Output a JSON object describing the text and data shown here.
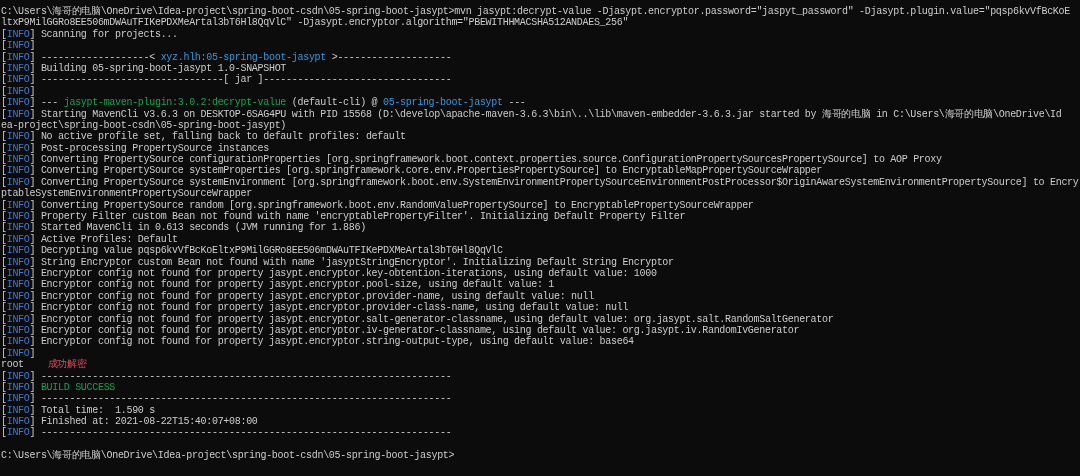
{
  "terminal": {
    "lines": [
      {
        "segments": [
          {
            "kind": "text",
            "text": "C:\\Users\\海哥的电脑\\OneDrive\\Idea-project\\spring-boot-csdn\\05-spring-boot-jasypt>mvn jasypt:decrypt-value -Djasypt.encryptor.password=\"jaspyt_password\" -Djasypt.plugin.value=\"pqsp6kvVfBcKoE"
          }
        ]
      },
      {
        "segments": [
          {
            "kind": "text",
            "text": "ltxP9MilGGRo8EE506mDWAuTFIKePDXMeArtal3bT6Hl8QqVlC\" -Djasypt.encryptor.algorithm=\"PBEWITHHMACSHA512ANDAES_256\""
          }
        ]
      },
      {
        "segments": [
          {
            "kind": "bracket",
            "text": "["
          },
          {
            "kind": "level",
            "text": "INFO"
          },
          {
            "kind": "bracket",
            "text": "]"
          },
          {
            "kind": "text",
            "text": "Scanning for projects..."
          }
        ]
      },
      {
        "segments": [
          {
            "kind": "bracket",
            "text": "["
          },
          {
            "kind": "level",
            "text": "INFO"
          },
          {
            "kind": "bracket",
            "text": "]"
          }
        ]
      },
      {
        "segments": [
          {
            "kind": "bracket",
            "text": "["
          },
          {
            "kind": "level",
            "text": "INFO"
          },
          {
            "kind": "bracket",
            "text": "]"
          },
          {
            "kind": "text",
            "text": "-------------------<"
          },
          {
            "kind": "artifact",
            "text": "xyz.hlh:05-spring-boot-jasypt"
          },
          {
            "kind": "text",
            "text": ">--------------------"
          }
        ]
      },
      {
        "segments": [
          {
            "kind": "bracket",
            "text": "["
          },
          {
            "kind": "level",
            "text": "INFO"
          },
          {
            "kind": "bracket",
            "text": "]"
          },
          {
            "kind": "text",
            "text": "Building 05-spring-boot-jasypt 1.0-SNAPSHOT"
          }
        ]
      },
      {
        "segments": [
          {
            "kind": "bracket",
            "text": "["
          },
          {
            "kind": "level",
            "text": "INFO"
          },
          {
            "kind": "bracket",
            "text": "]"
          },
          {
            "kind": "text",
            "text": "--------------------------------[ jar ]---------------------------------"
          }
        ]
      },
      {
        "segments": [
          {
            "kind": "bracket",
            "text": "["
          },
          {
            "kind": "level",
            "text": "INFO"
          },
          {
            "kind": "bracket",
            "text": "]"
          }
        ]
      },
      {
        "segments": [
          {
            "kind": "bracket",
            "text": "["
          },
          {
            "kind": "level",
            "text": "INFO"
          },
          {
            "kind": "bracket",
            "text": "]"
          },
          {
            "kind": "text",
            "text": "---"
          },
          {
            "kind": "plugin",
            "text": "jasypt-maven-plugin:3.0.2:decrypt-value"
          },
          {
            "kind": "text",
            "text": "(default-cli) @"
          },
          {
            "kind": "artifact",
            "text": "05-spring-boot-jasypt"
          },
          {
            "kind": "text",
            "text": "---"
          }
        ]
      },
      {
        "segments": [
          {
            "kind": "bracket",
            "text": "["
          },
          {
            "kind": "level",
            "text": "INFO"
          },
          {
            "kind": "bracket",
            "text": "]"
          },
          {
            "kind": "text",
            "text": "Starting MavenCli v3.6.3 on DESKTOP-6SAG4PU with PID 15568 (D:\\develop\\apache-maven-3.6.3\\bin\\..\\lib\\maven-embedder-3.6.3.jar started by 海哥的电脑 in C:\\Users\\海哥的电脑\\OneDrive\\Id"
          }
        ]
      },
      {
        "segments": [
          {
            "kind": "text",
            "text": "ea-project\\spring-boot-csdn\\05-spring-boot-jasypt)"
          }
        ]
      },
      {
        "segments": [
          {
            "kind": "bracket",
            "text": "["
          },
          {
            "kind": "level",
            "text": "INFO"
          },
          {
            "kind": "bracket",
            "text": "]"
          },
          {
            "kind": "text",
            "text": "No active profile set, falling back to default profiles: default"
          }
        ]
      },
      {
        "segments": [
          {
            "kind": "bracket",
            "text": "["
          },
          {
            "kind": "level",
            "text": "INFO"
          },
          {
            "kind": "bracket",
            "text": "]"
          },
          {
            "kind": "text",
            "text": "Post-processing PropertySource instances"
          }
        ]
      },
      {
        "segments": [
          {
            "kind": "bracket",
            "text": "["
          },
          {
            "kind": "level",
            "text": "INFO"
          },
          {
            "kind": "bracket",
            "text": "]"
          },
          {
            "kind": "text",
            "text": "Converting PropertySource configurationProperties [org.springframework.boot.context.properties.source.ConfigurationPropertySourcesPropertySource] to AOP Proxy"
          }
        ]
      },
      {
        "segments": [
          {
            "kind": "bracket",
            "text": "["
          },
          {
            "kind": "level",
            "text": "INFO"
          },
          {
            "kind": "bracket",
            "text": "]"
          },
          {
            "kind": "text",
            "text": "Converting PropertySource systemProperties [org.springframework.core.env.PropertiesPropertySource] to EncryptableMapPropertySourceWrapper"
          }
        ]
      },
      {
        "segments": [
          {
            "kind": "bracket",
            "text": "["
          },
          {
            "kind": "level",
            "text": "INFO"
          },
          {
            "kind": "bracket",
            "text": "]"
          },
          {
            "kind": "text",
            "text": "Converting PropertySource systemEnvironment [org.springframework.boot.env.SystemEnvironmentPropertySourceEnvironmentPostProcessor$OriginAwareSystemEnvironmentPropertySource] to Encry"
          }
        ]
      },
      {
        "segments": [
          {
            "kind": "text",
            "text": "ptableSystemEnvironmentPropertySourceWrapper"
          }
        ]
      },
      {
        "segments": [
          {
            "kind": "bracket",
            "text": "["
          },
          {
            "kind": "level",
            "text": "INFO"
          },
          {
            "kind": "bracket",
            "text": "]"
          },
          {
            "kind": "text",
            "text": "Converting PropertySource random [org.springframework.boot.env.RandomValuePropertySource] to EncryptablePropertySourceWrapper"
          }
        ]
      },
      {
        "segments": [
          {
            "kind": "bracket",
            "text": "["
          },
          {
            "kind": "level",
            "text": "INFO"
          },
          {
            "kind": "bracket",
            "text": "]"
          },
          {
            "kind": "text",
            "text": "Property Filter custom Bean not found with name 'encryptablePropertyFilter'. Initializing Default Property Filter"
          }
        ]
      },
      {
        "segments": [
          {
            "kind": "bracket",
            "text": "["
          },
          {
            "kind": "level",
            "text": "INFO"
          },
          {
            "kind": "bracket",
            "text": "]"
          },
          {
            "kind": "text",
            "text": "Started MavenCli in 0.613 seconds (JVM running for 1.886)"
          }
        ]
      },
      {
        "segments": [
          {
            "kind": "bracket",
            "text": "["
          },
          {
            "kind": "level",
            "text": "INFO"
          },
          {
            "kind": "bracket",
            "text": "]"
          },
          {
            "kind": "text",
            "text": "Active Profiles: Default"
          }
        ]
      },
      {
        "segments": [
          {
            "kind": "bracket",
            "text": "["
          },
          {
            "kind": "level",
            "text": "INFO"
          },
          {
            "kind": "bracket",
            "text": "]"
          },
          {
            "kind": "text",
            "text": "Decrypting value pqsp6kvVfBcKoEltxP9MilGGRo8EE506mDWAuTFIKePDXMeArtal3bT6Hl8QqVlC"
          }
        ]
      },
      {
        "segments": [
          {
            "kind": "bracket",
            "text": "["
          },
          {
            "kind": "level",
            "text": "INFO"
          },
          {
            "kind": "bracket",
            "text": "]"
          },
          {
            "kind": "text",
            "text": "String Encryptor custom Bean not found with name 'jasyptStringEncryptor'. Initializing Default String Encryptor"
          }
        ]
      },
      {
        "segments": [
          {
            "kind": "bracket",
            "text": "["
          },
          {
            "kind": "level",
            "text": "INFO"
          },
          {
            "kind": "bracket",
            "text": "]"
          },
          {
            "kind": "text",
            "text": "Encryptor config not found for property jasypt.encryptor.key-obtention-iterations, using default value: 1000"
          }
        ]
      },
      {
        "segments": [
          {
            "kind": "bracket",
            "text": "["
          },
          {
            "kind": "level",
            "text": "INFO"
          },
          {
            "kind": "bracket",
            "text": "]"
          },
          {
            "kind": "text",
            "text": "Encryptor config not found for property jasypt.encryptor.pool-size, using default value: 1"
          }
        ]
      },
      {
        "segments": [
          {
            "kind": "bracket",
            "text": "["
          },
          {
            "kind": "level",
            "text": "INFO"
          },
          {
            "kind": "bracket",
            "text": "]"
          },
          {
            "kind": "text",
            "text": "Encryptor config not found for property jasypt.encryptor.provider-name, using default value: null"
          }
        ]
      },
      {
        "segments": [
          {
            "kind": "bracket",
            "text": "["
          },
          {
            "kind": "level",
            "text": "INFO"
          },
          {
            "kind": "bracket",
            "text": "]"
          },
          {
            "kind": "text",
            "text": "Encryptor config not found for property jasypt.encryptor.provider-class-name, using default value: null"
          }
        ]
      },
      {
        "segments": [
          {
            "kind": "bracket",
            "text": "["
          },
          {
            "kind": "level",
            "text": "INFO"
          },
          {
            "kind": "bracket",
            "text": "]"
          },
          {
            "kind": "text",
            "text": "Encryptor config not found for property jasypt.encryptor.salt-generator-classname, using default value: org.jasypt.salt.RandomSaltGenerator"
          }
        ]
      },
      {
        "segments": [
          {
            "kind": "bracket",
            "text": "["
          },
          {
            "kind": "level",
            "text": "INFO"
          },
          {
            "kind": "bracket",
            "text": "]"
          },
          {
            "kind": "text",
            "text": "Encryptor config not found for property jasypt.encryptor.iv-generator-classname, using default value: org.jasypt.iv.RandomIvGenerator"
          }
        ]
      },
      {
        "segments": [
          {
            "kind": "bracket",
            "text": "["
          },
          {
            "kind": "level",
            "text": "INFO"
          },
          {
            "kind": "bracket",
            "text": "]"
          },
          {
            "kind": "text",
            "text": "Encryptor config not found for property jasypt.encryptor.string-output-type, using default value: base64"
          }
        ]
      },
      {
        "segments": [
          {
            "kind": "bracket",
            "text": "["
          },
          {
            "kind": "level",
            "text": "INFO"
          },
          {
            "kind": "bracket",
            "text": "]"
          }
        ]
      },
      {
        "segments": [
          {
            "kind": "text",
            "text": "root"
          },
          {
            "kind": "alert",
            "text": "成功解密"
          }
        ]
      },
      {
        "segments": [
          {
            "kind": "bracket",
            "text": "["
          },
          {
            "kind": "level",
            "text": "INFO"
          },
          {
            "kind": "bracket",
            "text": "]"
          },
          {
            "kind": "text",
            "text": "------------------------------------------------------------------------"
          }
        ]
      },
      {
        "segments": [
          {
            "kind": "bracket",
            "text": "["
          },
          {
            "kind": "level",
            "text": "INFO"
          },
          {
            "kind": "bracket",
            "text": "]"
          },
          {
            "kind": "success",
            "text": "BUILD SUCCESS"
          }
        ]
      },
      {
        "segments": [
          {
            "kind": "bracket",
            "text": "["
          },
          {
            "kind": "level",
            "text": "INFO"
          },
          {
            "kind": "bracket",
            "text": "]"
          },
          {
            "kind": "text",
            "text": "------------------------------------------------------------------------"
          }
        ]
      },
      {
        "segments": [
          {
            "kind": "bracket",
            "text": "["
          },
          {
            "kind": "level",
            "text": "INFO"
          },
          {
            "kind": "bracket",
            "text": "]"
          },
          {
            "kind": "text",
            "text": "Total time:  1.590 s"
          }
        ]
      },
      {
        "segments": [
          {
            "kind": "bracket",
            "text": "["
          },
          {
            "kind": "level",
            "text": "INFO"
          },
          {
            "kind": "bracket",
            "text": "]"
          },
          {
            "kind": "text",
            "text": "Finished at: 2021-08-22T15:40:07+08:00"
          }
        ]
      },
      {
        "segments": [
          {
            "kind": "bracket",
            "text": "["
          },
          {
            "kind": "level",
            "text": "INFO"
          },
          {
            "kind": "bracket",
            "text": "]"
          },
          {
            "kind": "text",
            "text": "------------------------------------------------------------------------"
          }
        ]
      },
      {
        "blank": true
      },
      {
        "segments": [
          {
            "kind": "text",
            "text": "C:\\Users\\海哥的电脑\\OneDrive\\Idea-project\\spring-boot-csdn\\05-spring-boot-jasypt>"
          }
        ]
      }
    ]
  }
}
